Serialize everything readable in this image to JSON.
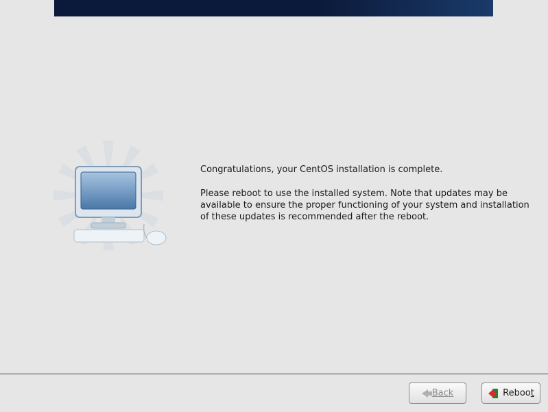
{
  "main": {
    "congrats": "Congratulations, your CentOS installation is complete.",
    "reboot_notice": "Please reboot to use the installed system.  Note that updates may be available to ensure the proper functioning of your system and installation of these updates is recommended after the reboot."
  },
  "footer": {
    "back_label": "Back",
    "reboot_label": "Reboot"
  }
}
